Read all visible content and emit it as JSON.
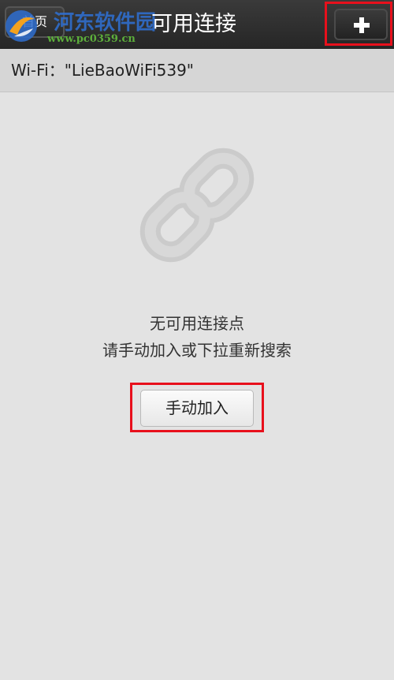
{
  "header": {
    "back_label": "首页",
    "title": "可用连接",
    "add_icon": "plus-icon"
  },
  "watermark": {
    "title": "河东软件园",
    "url": "www.pc0359.cn"
  },
  "wifi": {
    "status_text": "Wi-Fi：\"LieBaoWiFi539\""
  },
  "empty_state": {
    "icon": "link-icon",
    "title": "无可用连接点",
    "hint": "请手动加入或下拉重新搜索",
    "manual_button_label": "手动加入"
  },
  "colors": {
    "header_bg": "#2e2e2e",
    "page_bg": "#e3e3e3",
    "highlight": "#e8101c",
    "watermark_blue": "#2f6fd0",
    "watermark_green": "#5cae3b"
  }
}
